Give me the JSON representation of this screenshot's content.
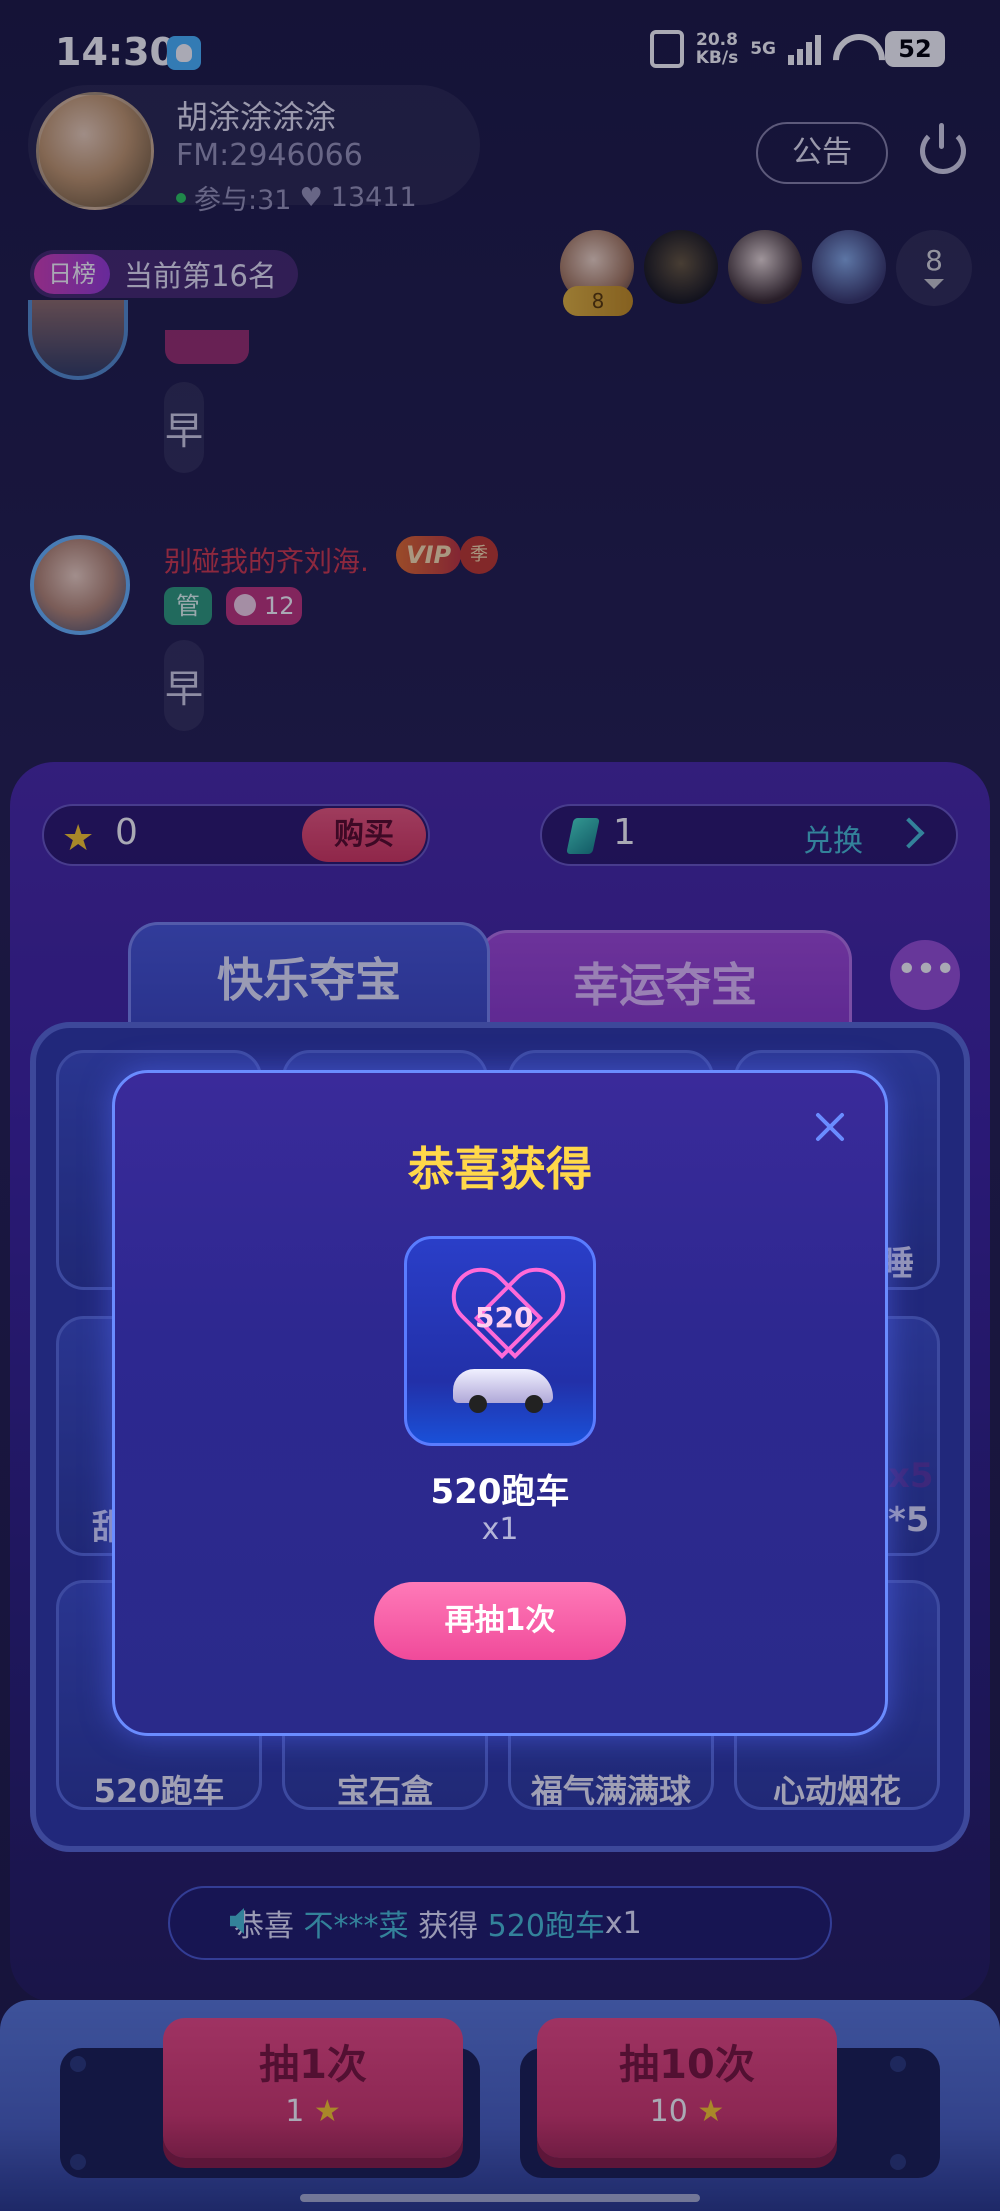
{
  "status_bar": {
    "time": "14:30",
    "net_speed_value": "20.8",
    "net_speed_unit": "KB/s",
    "network_type": "5G",
    "battery": "52"
  },
  "room": {
    "host_name": "胡涂涂涂涂",
    "fm_id": "FM:2946066",
    "participants": "参与:31",
    "likes": "13411",
    "notice_label": "公告",
    "rank_badge": "日榜",
    "rank_text": "当前第16名",
    "audience_badge": "8",
    "audience_total": "8"
  },
  "chat": {
    "messages": [
      {
        "text": "早"
      },
      {
        "user": "别碰我的齐刘海.",
        "vip": "VIP",
        "vip_season": "季",
        "admin": "管",
        "level": "12",
        "text": "早"
      }
    ],
    "partial_level": "12"
  },
  "lottery": {
    "stars": "0",
    "buy_label": "购买",
    "gems": "1",
    "exchange_label": "兑换",
    "tabs": [
      "快乐夺宝",
      "幸运夺宝"
    ],
    "more_label": "•••",
    "prizes_bottom_row": [
      "520跑车",
      "宝石盒",
      "福气满满球",
      "心动烟花"
    ],
    "partial_labels": [
      "睡",
      "x5",
      "*5",
      "甜"
    ],
    "ticker": {
      "prefix": "恭喜",
      "user": "不***菜",
      "middle": "获得",
      "prize": "520跑车",
      "qty": "x1"
    },
    "draw_buttons": [
      {
        "label": "抽1次",
        "cost": "1"
      },
      {
        "label": "抽10次",
        "cost": "10"
      }
    ]
  },
  "modal": {
    "title": "恭喜获得",
    "prize_art_text": "520",
    "prize_name": "520跑车",
    "prize_qty": "x1",
    "redraw_label": "再抽1次"
  }
}
